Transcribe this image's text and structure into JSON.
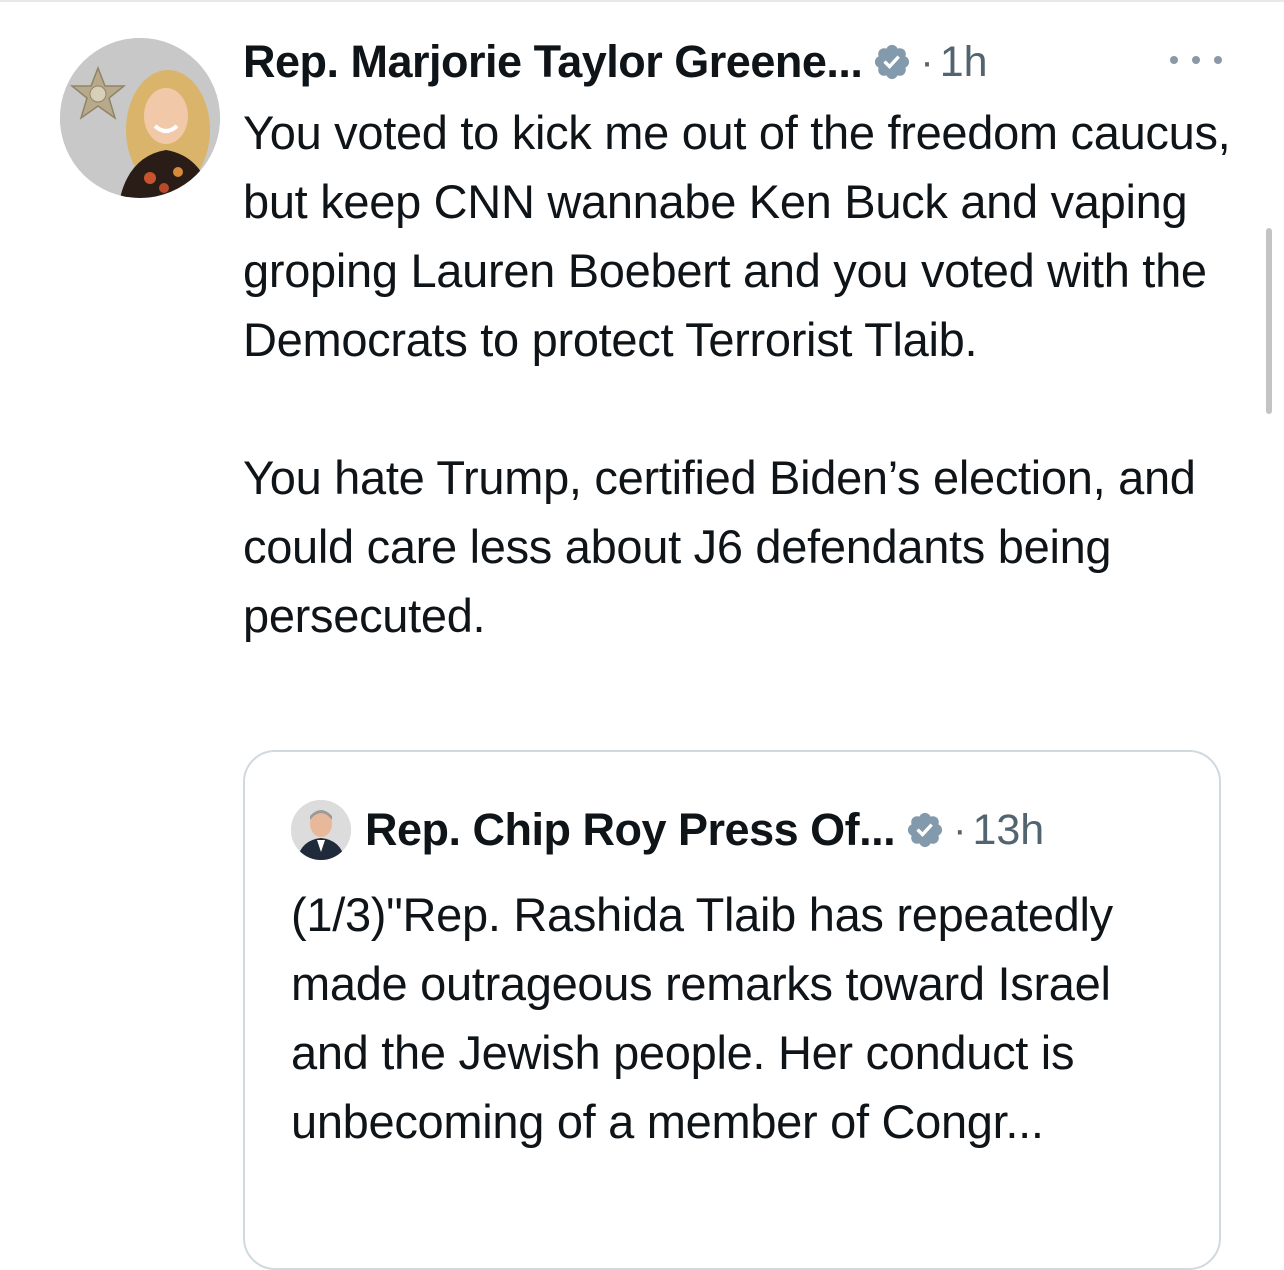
{
  "tweet": {
    "author_name": "Rep. Marjorie Taylor Greene...",
    "separator": "·",
    "time": "1h",
    "paragraphs": [
      "You voted to kick me out of the freedom caucus, but keep CNN wannabe Ken Buck and vaping groping Lauren Boebert and you voted with the Democrats to protect Terrorist Tlaib.",
      "You hate Trump, certified Biden’s election, and could care less about J6 defendants being persecuted."
    ]
  },
  "quoted_tweet": {
    "author_name": "Rep. Chip Roy Press Of...",
    "separator": "·",
    "time": "13h",
    "text": "(1/3)\"Rep. Rashida Tlaib has repeatedly made outrageous remarks toward Israel and the Jewish people. Her conduct is unbecoming of a member of Congr..."
  },
  "icons": {
    "verified": "verified-badge-icon",
    "more": "more-options-icon"
  },
  "colors": {
    "text_primary": "#0f1419",
    "text_secondary": "#536471",
    "border": "#cfd9de",
    "verified_badge": "#829aab"
  }
}
